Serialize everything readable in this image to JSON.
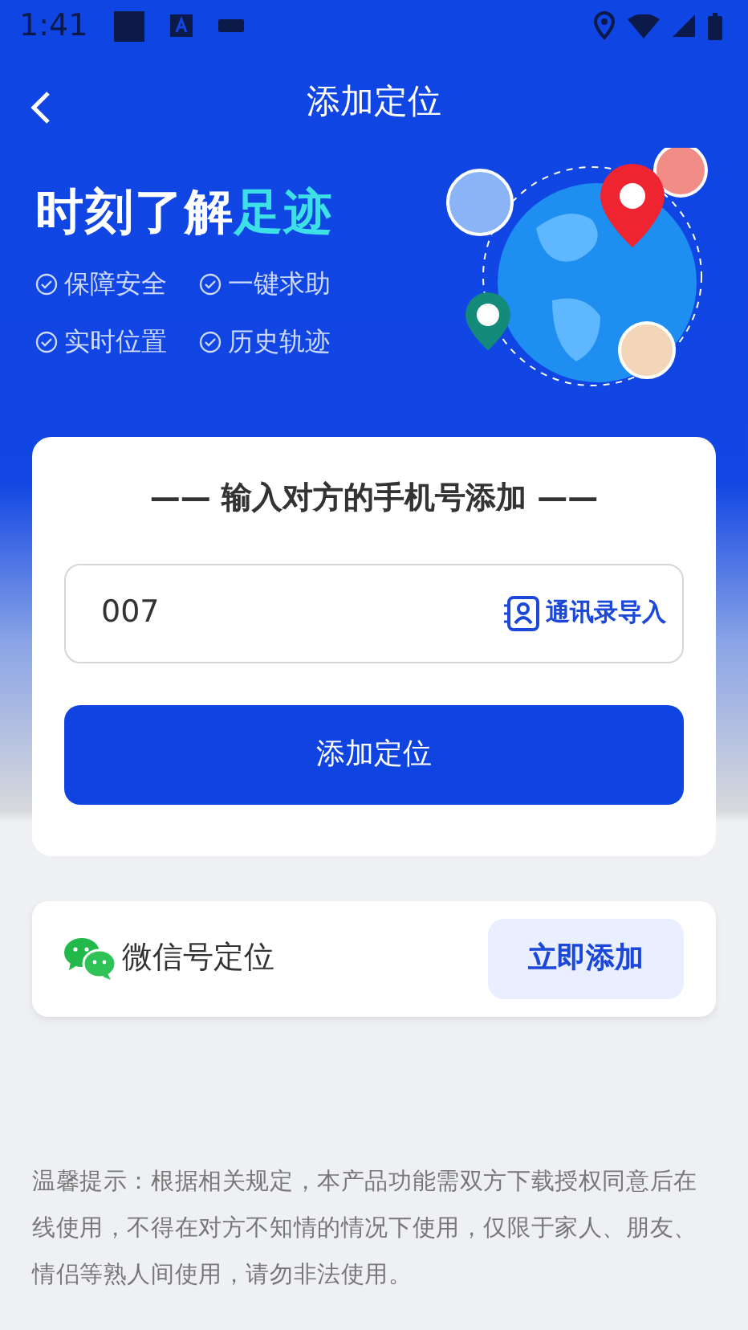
{
  "status_bar": {
    "time": "1:41"
  },
  "header": {
    "title": "添加定位"
  },
  "hero": {
    "headline": "时刻了解**足迹**",
    "features": [
      {
        "label": "保障安全"
      },
      {
        "label": "一键求助"
      },
      {
        "label": "实时位置"
      },
      {
        "label": "历史轨迹"
      }
    ]
  },
  "phone_card": {
    "title": "—— 输入对方的手机号添加 ——",
    "phone_input": {
      "value": "007"
    },
    "contacts_link": "通讯录导入",
    "submit_button": "添加定位"
  },
  "wechat_card": {
    "label": "微信号定位",
    "button": "立即添加"
  },
  "notice": "温馨提示：根据相关规定，本产品功能需双方下载授权同意后在线使用，不得在对方不知情的情况下使用，仅限于家人、朋友、情侣等熟人间使用，请勿非法使用。"
}
